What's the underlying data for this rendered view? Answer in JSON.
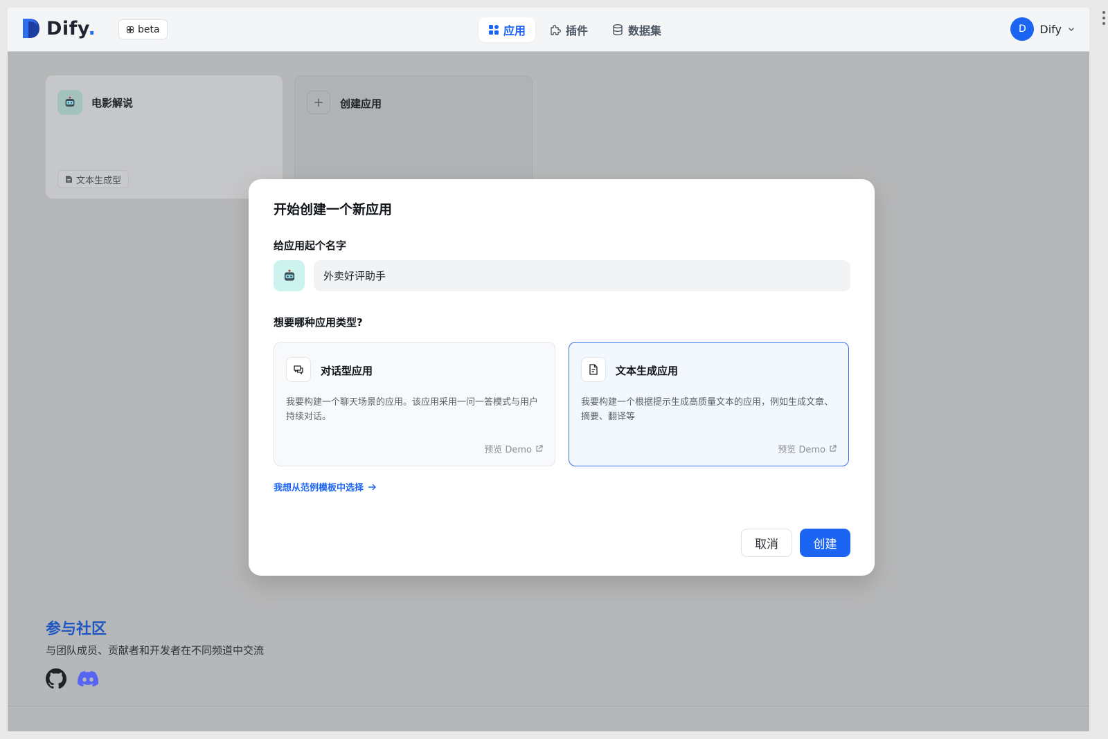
{
  "header": {
    "logo_text": "Dify",
    "logo_dot": ".",
    "beta_label": "beta",
    "nav": [
      {
        "label": "应用",
        "icon": "grid-icon",
        "active": true
      },
      {
        "label": "插件",
        "icon": "puzzle-icon",
        "active": false
      },
      {
        "label": "数据集",
        "icon": "database-icon",
        "active": false
      }
    ],
    "user": {
      "initial": "D",
      "name": "Dify"
    }
  },
  "apps": [
    {
      "title": "电影解说",
      "icon": "robot-icon",
      "tag": "文本生成型"
    }
  ],
  "create_card": {
    "label": "创建应用"
  },
  "community": {
    "title": "参与社区",
    "description": "与团队成员、贡献者和开发者在不同频道中交流",
    "icons": [
      "github-icon",
      "discord-icon"
    ]
  },
  "modal": {
    "title": "开始创建一个新应用",
    "name_label": "给应用起个名字",
    "name_value": "外卖好评助手",
    "type_label": "想要哪种应用类型?",
    "types": [
      {
        "title": "对话型应用",
        "description": "我要构建一个聊天场景的应用。该应用采用一问一答模式与用户持续对话。",
        "demo": "预览 Demo",
        "selected": false
      },
      {
        "title": "文本生成应用",
        "description": "我要构建一个根据提示生成高质量文本的应用，例如生成文章、摘要、翻译等",
        "demo": "预览 Demo",
        "selected": true
      }
    ],
    "template_link": "我想从范例模板中选择",
    "cancel_label": "取消",
    "create_label": "创建"
  },
  "colors": {
    "accent": "#1c64f2",
    "selected_border": "#2a6fe6",
    "overlay": "#b6b7b8"
  }
}
